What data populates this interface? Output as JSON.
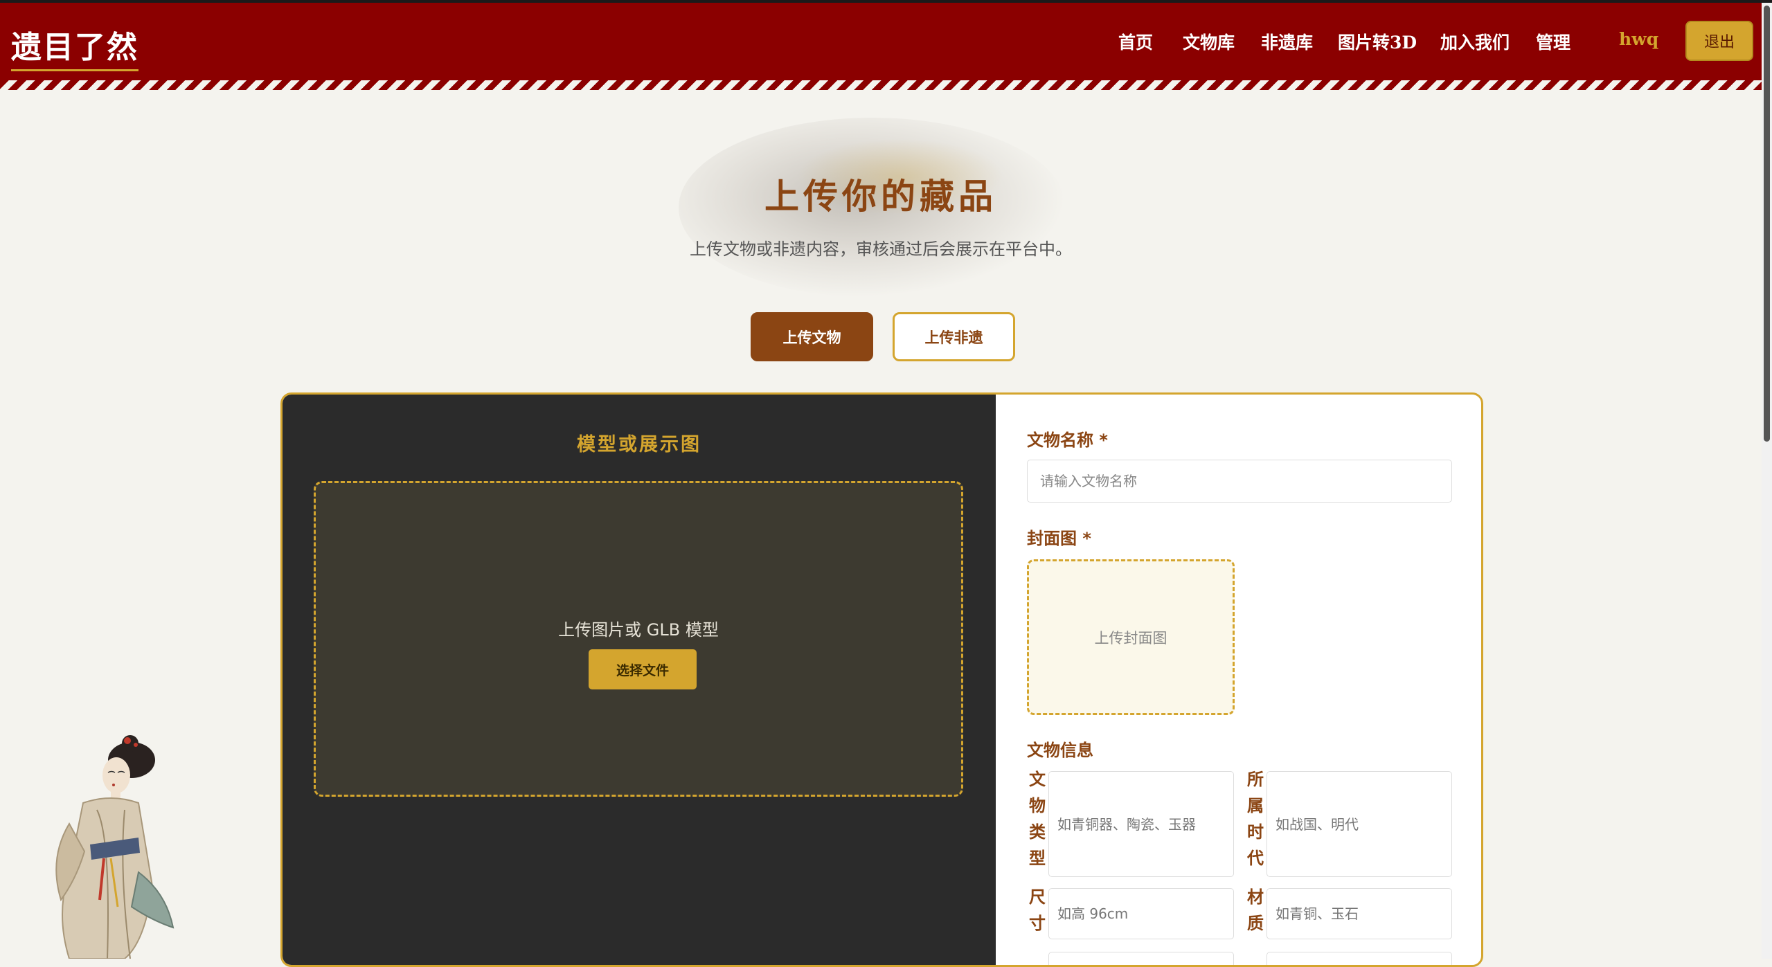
{
  "brand": {
    "logo": "遗目了然"
  },
  "nav": {
    "items": [
      "首页",
      "文物库",
      "非遗库",
      "图片转3D",
      "加入我们",
      "管理"
    ],
    "user": "hwq",
    "logout": "退出"
  },
  "hero": {
    "title": "上传你的藏品",
    "subtitle": "上传文物或非遗内容，审核通过后会展示在平台中。"
  },
  "tabs": {
    "artifact": "上传文物",
    "heritage": "上传非遗"
  },
  "left": {
    "title": "模型或展示图",
    "drop_text": "上传图片或 GLB 模型",
    "choose_button": "选择文件"
  },
  "form": {
    "name_label": "文物名称 *",
    "name_placeholder": "请输入文物名称",
    "cover_label": "封面图 *",
    "cover_text": "上传封面图",
    "info_label": "文物信息",
    "type_label": "文物类型",
    "type_placeholder": "如青铜器、陶瓷、玉器",
    "era_label": "所属时代",
    "era_placeholder": "如战国、明代",
    "size_label": "尺寸",
    "size_placeholder": "如高 96cm",
    "material_label": "材质",
    "material_placeholder": "如青铜、玉石"
  },
  "colors": {
    "nav_bg": "#8b0000",
    "accent_gold": "#d4a52e",
    "accent_brown": "#8b4513",
    "page_bg": "#f4f3ee",
    "panel_dark": "#2b2b2b"
  }
}
